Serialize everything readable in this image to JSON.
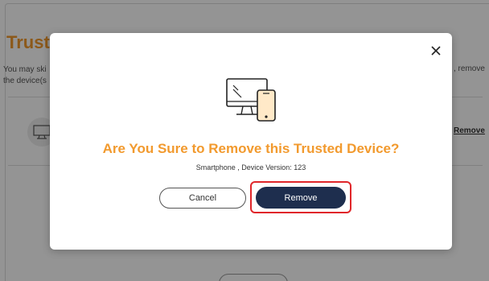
{
  "background": {
    "title": "Trust",
    "description_left_line1": "You may ski",
    "description_left_line2": "the device(s",
    "description_right": ", remove",
    "remove_link": "Remove"
  },
  "modal": {
    "title": "Are You Sure to Remove this Trusted Device?",
    "subtitle": "Smartphone , Device Version: 123",
    "cancel_label": "Cancel",
    "remove_label": "Remove",
    "close_symbol": "✕",
    "illustration_icon": "desktop-and-smartphone-icon"
  },
  "colors": {
    "accent_orange": "#f29a2e",
    "primary_navy": "#1e2e4e",
    "highlight_red": "#e0262a"
  }
}
